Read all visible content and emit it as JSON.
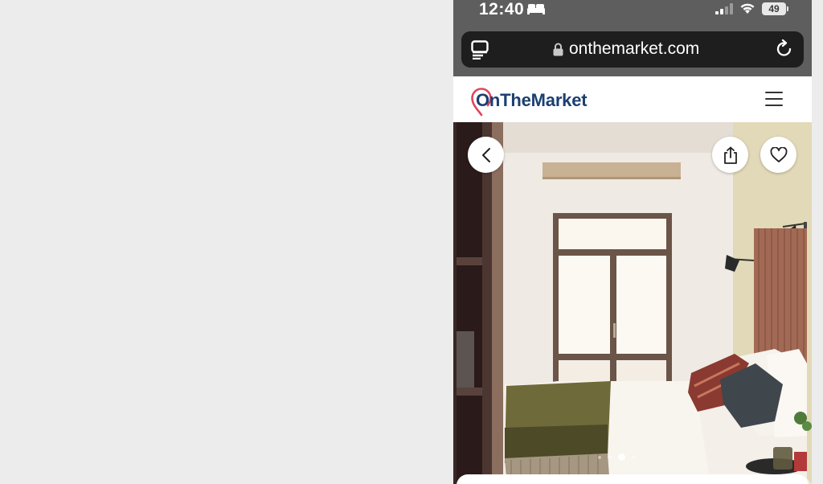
{
  "status_bar": {
    "time": "12:40",
    "battery": "49",
    "icons": [
      "bed-icon",
      "cellular-signal-icon",
      "wifi-icon",
      "battery-icon"
    ]
  },
  "browser": {
    "url": "onthemarket.com",
    "icons": [
      "tabs-icon",
      "lock-icon",
      "reload-icon"
    ]
  },
  "site": {
    "logo_text": "OnTheMarket",
    "brand_color": "#1b3f72",
    "pin_color": "#e0455b",
    "icons": [
      "logo-pin-icon",
      "menu-icon"
    ]
  },
  "gallery": {
    "buttons": [
      "back-button",
      "share-button",
      "favourite-button"
    ],
    "dots_count": 4,
    "active_dot": 3
  }
}
